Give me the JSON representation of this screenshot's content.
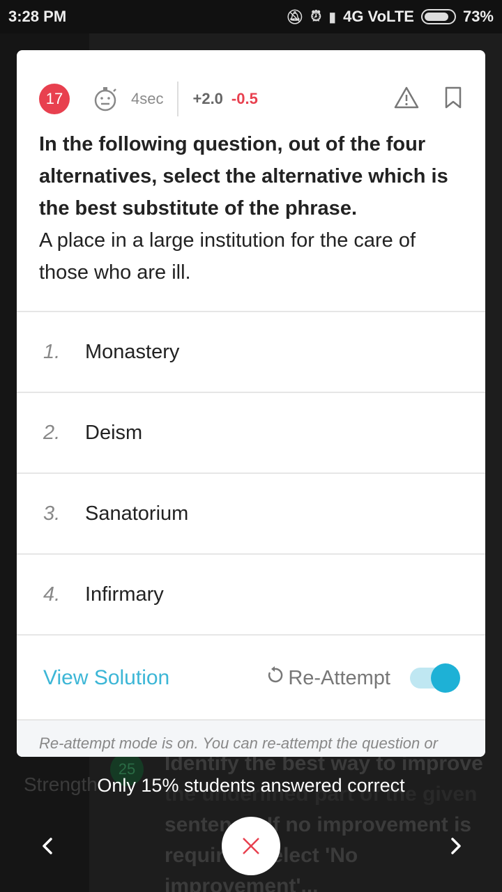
{
  "status_bar": {
    "time": "3:28 PM",
    "network": "4G VoLTE",
    "battery": "73%"
  },
  "question": {
    "number": "17",
    "time_spent": "4sec",
    "positive_marks": "+2.0",
    "negative_marks": "-0.5",
    "instruction": "In the following question, out of the four alternatives, select the alternative which is the best substitute of the phrase.",
    "text": "A place in a large institution for the care of those who are ill."
  },
  "options": [
    {
      "num": "1.",
      "label": "Monastery"
    },
    {
      "num": "2.",
      "label": "Deism"
    },
    {
      "num": "3.",
      "label": "Sanatorium"
    },
    {
      "num": "4.",
      "label": "Infirmary"
    }
  ],
  "actions": {
    "view_solution": "View Solution",
    "reattempt": "Re-Attempt",
    "reattempt_on": true
  },
  "notice": "Re-attempt mode is on. You can re-attempt the question or",
  "toast": "Only 15% students answered correct",
  "background": {
    "badge": "25",
    "side_label": "Strength",
    "line1": "Identify the best way to improve",
    "line2": "the underlined part of the given",
    "line3": "sentence. If no improvement is",
    "line4": "required, select 'No improvement'..."
  },
  "colors": {
    "accent": "#1eb1d6",
    "link": "#3cb6d6",
    "negative": "#e8404f"
  },
  "icons": [
    "timer-icon",
    "warning-icon",
    "bookmark-icon",
    "refresh-icon",
    "chevron-left-icon",
    "chevron-right-icon",
    "close-icon"
  ]
}
